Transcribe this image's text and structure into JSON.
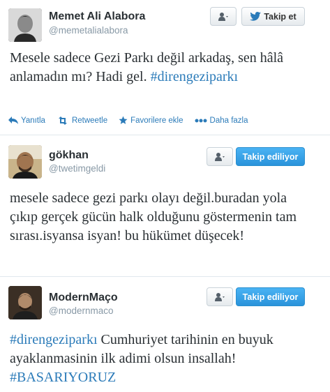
{
  "tweets": [
    {
      "name": "Memet Ali Alabora",
      "handle": "@memetalialabora",
      "follow_label": "Takip et",
      "text_plain": "Mesele sadece Gezi Parkı değil arkadaş, sen hâlâ anlamadın mı? Hadi gel.",
      "hashtag": "#direngeziparkı",
      "actions": {
        "reply": "Yanıtla",
        "retweet": "Retweetle",
        "favorite": "Favorilere ekle",
        "more": "Daha fazla"
      }
    },
    {
      "name": "gökhan",
      "handle": "@twetimgeldi",
      "follow_label": "Takip ediliyor",
      "text": "mesele sadece gezi parkı olayı değil.buradan yola çıkıp gerçek gücün halk olduğunu göstermenin tam sırası.isyansa isyan! bu hükümet düşecek!"
    },
    {
      "name": "ModernMaço",
      "handle": "@modernmaco",
      "follow_label": "Takip ediliyor",
      "hashtag1": "#direngeziparkı",
      "text_middle": "Cumhuriyet tarihinin en buyuk ayaklanmasinin ilk adimi olsun insallah!",
      "hashtag2": "#BASARIYORUZ"
    }
  ],
  "colors": {
    "link": "#2b7bb9",
    "follow_blue": "#2a93db",
    "text": "#292f33",
    "muted": "#8899a6"
  },
  "icons": [
    "user-dropdown-icon",
    "twitter-bird-icon",
    "reply-icon",
    "retweet-icon",
    "star-icon",
    "more-dots-icon"
  ]
}
